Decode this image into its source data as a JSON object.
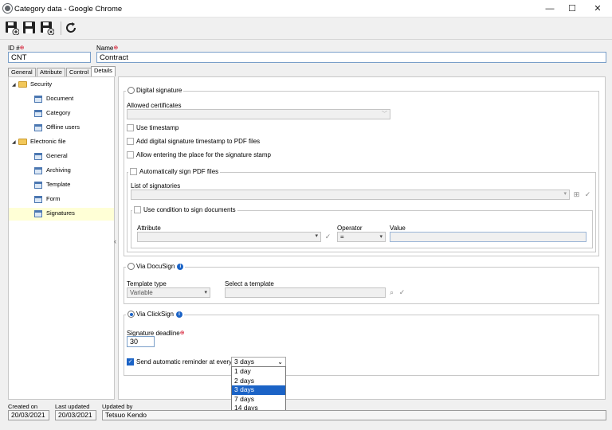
{
  "window": {
    "title": "Category data - Google Chrome",
    "min": "—",
    "max": "☐",
    "close": "✕"
  },
  "toolbar": {
    "save_new": "save-new",
    "save": "save",
    "save_close": "save-close",
    "refresh": "refresh"
  },
  "fields": {
    "id_label": "ID #",
    "id_value": "CNT",
    "name_label": "Name",
    "name_value": "Contract"
  },
  "tabs": [
    "General",
    "Attribute",
    "Control",
    "Details"
  ],
  "tree": {
    "security": "Security",
    "security_items": [
      "Document",
      "Category",
      "Offline users"
    ],
    "electronic": "Electronic file",
    "electronic_items": [
      "General",
      "Archiving",
      "Template",
      "Form",
      "Signatures"
    ]
  },
  "digital": {
    "title": "Digital signature",
    "allowed_certificates": "Allowed certificates",
    "use_timestamp": "Use timestamp",
    "add_timestamp": "Add digital signature timestamp to PDF files",
    "allow_place": "Allow entering the place for the signature stamp",
    "auto_sign": "Automatically sign PDF files",
    "list_signatories": "List of signatories",
    "use_condition": "Use condition to sign documents",
    "attribute": "Attribute",
    "operator": "Operator",
    "operator_value": "=",
    "value": "Value"
  },
  "docusign": {
    "title": "Via DocuSign",
    "template_type": "Template type",
    "template_type_value": "Variable",
    "select_template": "Select a template"
  },
  "clicksign": {
    "title": "Via ClickSign",
    "deadline_label": "Signature deadline",
    "deadline_value": "30",
    "reminder_label": "Send automatic reminder at every",
    "reminder_value": "3 days",
    "options": [
      "1 day",
      "2 days",
      "3 days",
      "7 days",
      "14 days"
    ]
  },
  "status": {
    "created_label": "Created on",
    "created": "20/03/2021",
    "updated_label": "Last updated",
    "updated": "20/03/2021",
    "by_label": "Updated by",
    "by": "Tetsuo Kendo"
  }
}
